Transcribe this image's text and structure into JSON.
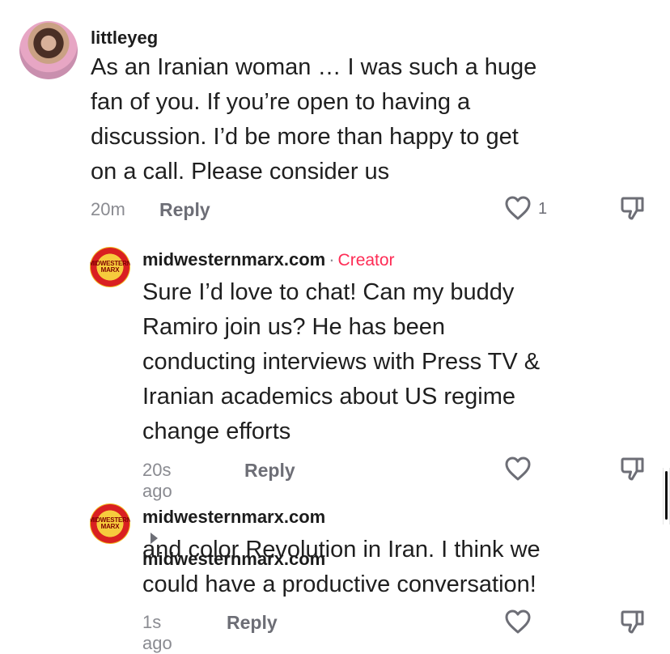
{
  "comments": [
    {
      "username": "littleyeg",
      "text_lines": [
        "As an Iranian woman … I was such a huge",
        "fan of you. If you’re open to having a",
        "discussion. I’d be more than happy to get",
        "on a call. Please consider us"
      ],
      "time": "20m",
      "reply_label": "Reply",
      "like_count": "1"
    },
    {
      "username": "midwesternmarx.com",
      "separator": "·",
      "badge": "Creator",
      "text_lines": [
        "Sure I’d love to chat! Can my buddy",
        "Ramiro join us? He has been",
        "conducting interviews with Press TV &",
        "Iranian academics about US regime",
        "change efforts"
      ],
      "time": "20s ago",
      "reply_label": "Reply"
    },
    {
      "username": "midwesternmarx.com",
      "reply_to": "midwesternmarx.com",
      "text_lines": [
        "and color Revolution in Iran. I think we",
        "could have a productive conversation!"
      ],
      "time": "1s ago",
      "reply_label": "Reply"
    }
  ],
  "brand_avatar_text": "MIDWESTERN MARX",
  "icons": {
    "like": "heart-outline-icon",
    "dislike": "thumbs-down-icon",
    "arrow": "right-triangle-icon"
  },
  "colors": {
    "creator": "#fe2c55",
    "text": "#1f1f1f",
    "muted": "#8a8b91"
  }
}
